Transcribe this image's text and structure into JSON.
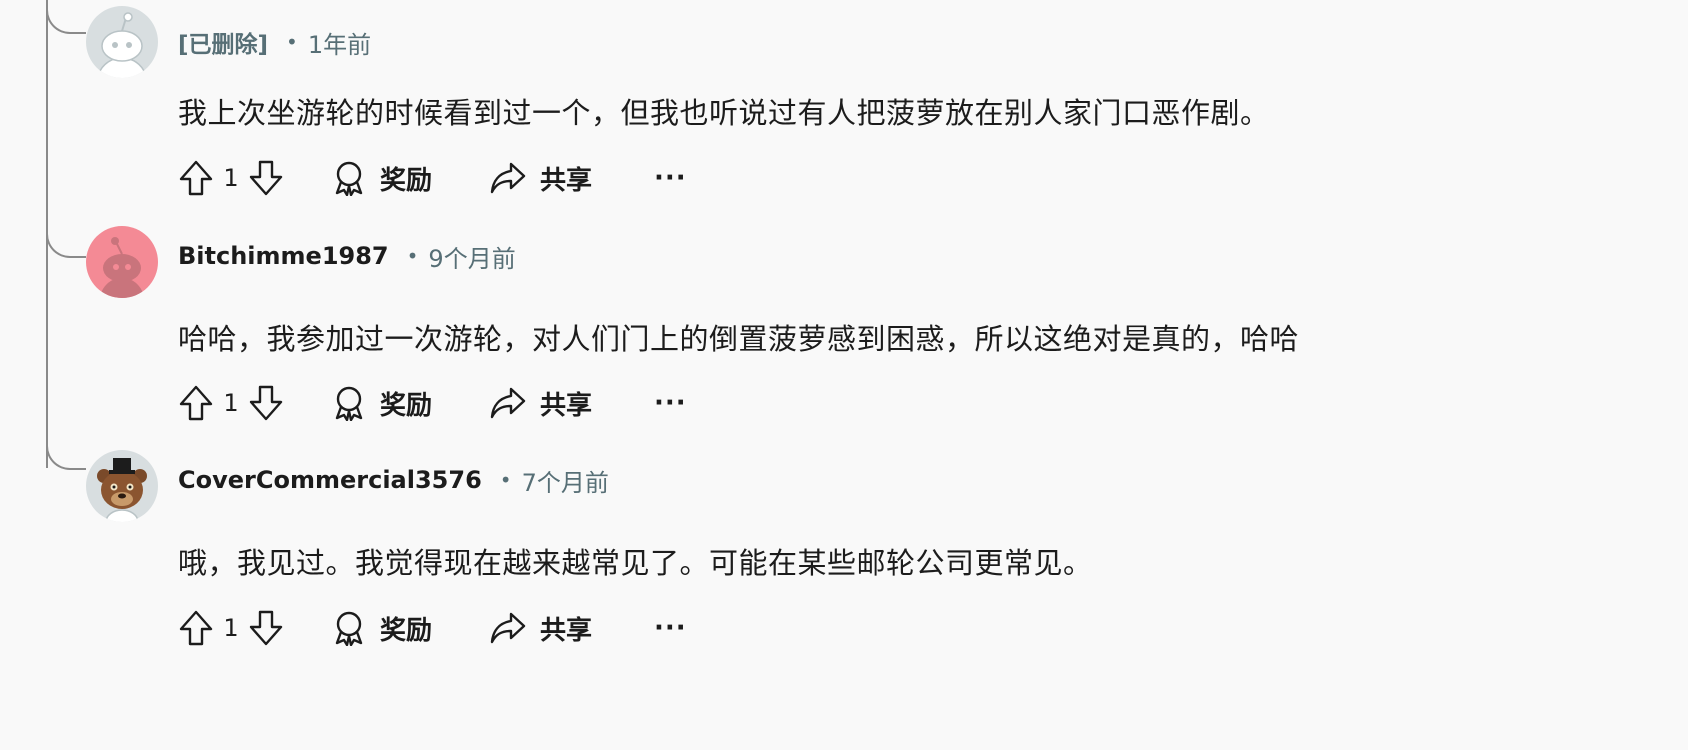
{
  "comments": [
    {
      "author": "[已删除]",
      "time": "1年前",
      "body": "我上次坐游轮的时候看到过一个，但我也听说过有人把菠萝放在别人家门口恶作剧。",
      "votes": "1",
      "award_label": "奖励",
      "share_label": "共享",
      "more_label": "···",
      "avatar_color": "#d8dee0"
    },
    {
      "author": "Bitchimme1987",
      "time": "9个月前",
      "body": "哈哈，我参加过一次游轮，对人们门上的倒置菠萝感到困惑，所以这绝对是真的，哈哈",
      "votes": "1",
      "award_label": "奖励",
      "share_label": "共享",
      "more_label": "···",
      "avatar_color": "#f48a95"
    },
    {
      "author": "CoverCommercial3576",
      "time": "7个月前",
      "body": "哦，我见过。我觉得现在越来越常见了。可能在某些邮轮公司更常见。",
      "votes": "1",
      "award_label": "奖励",
      "share_label": "共享",
      "more_label": "···",
      "avatar_color": "#d8dee0"
    }
  ],
  "separator": "•"
}
